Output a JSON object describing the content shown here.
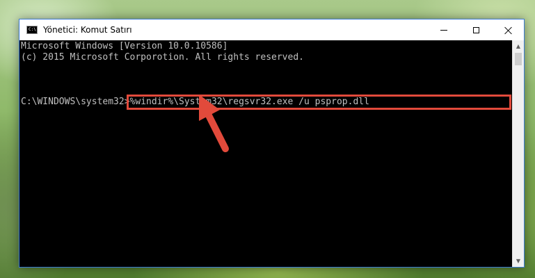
{
  "window": {
    "title": "Yönetici: Komut Satırı",
    "controls": {
      "minimize": "minimize-icon",
      "maximize": "maximize-icon",
      "close": "close-icon"
    }
  },
  "console": {
    "lines": [
      "Microsoft Windows [Version 10.0.10586]",
      "(c) 2015 Microsoft Corporotion. All rights reserved."
    ],
    "prompt": "C:\\WINDOWS\\system32>",
    "command": "%windir%\\System32\\regsvr32.exe /u psprop.dll"
  },
  "colors": {
    "highlight": "#e24a3b",
    "arrow": "#e24a3b",
    "console_text": "#c0c0c0",
    "console_bg": "#000000"
  },
  "icons": {
    "app": "cmd-icon",
    "pointer": "red-arrow-icon",
    "scroll_up": "chevron-up-icon",
    "scroll_down": "chevron-down-icon"
  }
}
